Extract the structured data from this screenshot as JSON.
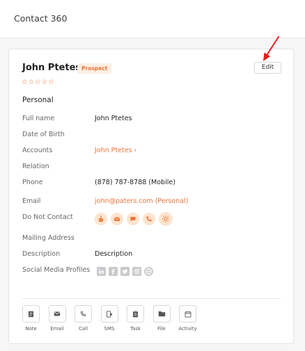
{
  "header": {
    "title": "Contact 360"
  },
  "contact": {
    "name": "John Ptetes",
    "badge": "Prospect",
    "stars": "☆☆☆☆☆",
    "edit_label": "Edit"
  },
  "section_title": "Personal",
  "fields": {
    "full_name_label": "Full name",
    "full_name_value": "John Ptetes",
    "dob_label": "Date of Birth",
    "accounts_label": "Accounts",
    "accounts_value": "John Ptetes ›",
    "relation_label": "Relation",
    "phone_label": "Phone",
    "phone_value": "(878) 787-8788 (Mobile)",
    "email_label": "Email",
    "email_value": "john@paters.com  (Personal)",
    "dnc_label": "Do Not Contact",
    "mailing_label": "Mailing Address",
    "description_label": "Description",
    "description_value": "Description",
    "social_label": "Social Media Profiles"
  },
  "do_not_contact_icons": [
    "robot-icon",
    "mail-icon",
    "chat-icon",
    "phone-icon",
    "sun-icon"
  ],
  "social_icons": [
    "linkedin-icon",
    "facebook-icon",
    "twitter-icon",
    "instagram-icon",
    "globe-icon"
  ],
  "actions": [
    {
      "label": "Note",
      "icon": "note-icon"
    },
    {
      "label": "Email",
      "icon": "mail-icon"
    },
    {
      "label": "Call",
      "icon": "phone-icon"
    },
    {
      "label": "SMS",
      "icon": "sms-icon"
    },
    {
      "label": "Task",
      "icon": "task-icon"
    },
    {
      "label": "File",
      "icon": "folder-icon"
    },
    {
      "label": "Activity",
      "icon": "calendar-icon"
    }
  ],
  "colors": {
    "accent": "#e8763a",
    "badge_bg": "#fdeee3",
    "annotation_arrow": "#e02020"
  }
}
